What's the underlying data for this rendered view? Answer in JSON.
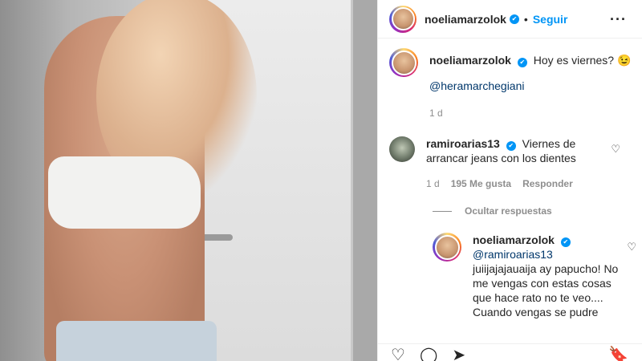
{
  "post": {
    "author": "noeliamarzolok",
    "follow_label": "Seguir",
    "caption": "Hoy es viernes? 😉",
    "caption_mention": "@heramarchegiani",
    "caption_time": "1 d"
  },
  "comment": {
    "author": "ramiroarias13",
    "text": "Viernes de arrancar jeans con los dientes",
    "time": "1 d",
    "likes": "195 Me gusta",
    "reply_label": "Responder"
  },
  "hide_replies_label": "Ocultar respuestas",
  "reply": {
    "author": "noeliamarzolok",
    "mention": "@ramiroarias13",
    "text": "juiijajajauaija ay papucho! No me vengas con estas cosas que hace rato no te veo.... Cuando vengas se pudre"
  },
  "icons": {
    "verified": "✔",
    "more": "···",
    "heart": "♡",
    "like": "♡",
    "comment": "◯",
    "share": "➤",
    "save": "🔖"
  },
  "colors": {
    "accent": "#0095f6",
    "mention": "#00376b",
    "meta": "#8e8e8e"
  }
}
